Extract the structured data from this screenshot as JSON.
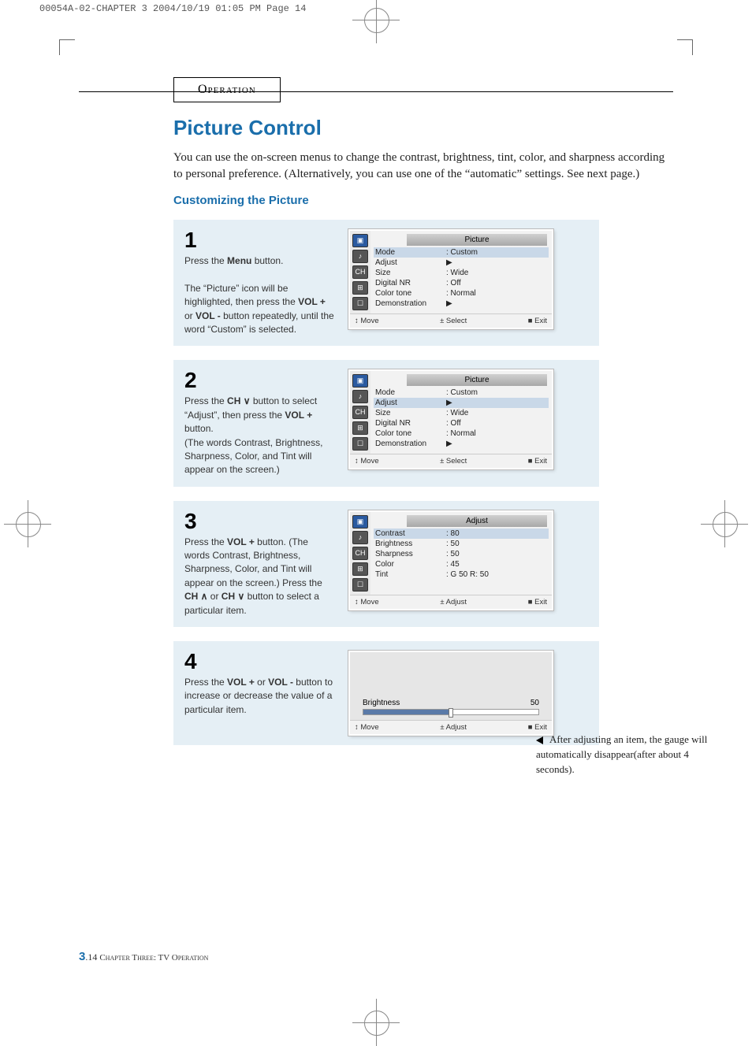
{
  "header_slug": "00054A-02-CHAPTER 3  2004/10/19  01:05 PM  Page 14",
  "section_label": "Operation",
  "title": "Picture Control",
  "intro": "You can use the on-screen menus to change the contrast, brightness, tint, color, and sharpness according to personal preference. (Alternatively, you can use one of the “automatic” settings. See next page.)",
  "subhead": "Customizing the Picture",
  "steps": [
    {
      "num": "1",
      "text_p1": "Press the ",
      "text_b1": "Menu",
      "text_p2": " button.",
      "text_p3": "The “Picture” icon will be highlighted, then press the ",
      "text_b2": "VOL +",
      "text_mid": " or ",
      "text_b3": "VOL -",
      "text_p4": " button repeatedly, until the word “Custom” is selected.",
      "osd_type": "picture",
      "osd": {
        "title": "Picture",
        "rows": [
          {
            "label": "Mode",
            "val": ": Custom",
            "highlight": true
          },
          {
            "label": "Adjust",
            "val": "▶"
          },
          {
            "label": "Size",
            "val": ": Wide"
          },
          {
            "label": "Digital NR",
            "val": ": Off"
          },
          {
            "label": "Color tone",
            "val": ": Normal"
          },
          {
            "label": "Demonstration",
            "val": "▶"
          }
        ],
        "footer": {
          "left": "↕ Move",
          "mid": "± Select",
          "right": "■ Exit"
        }
      }
    },
    {
      "num": "2",
      "text_p1": "Press the  ",
      "text_b1": "CH ∨",
      "text_p2": "  button to select “Adjust”, then press the ",
      "text_b2": "VOL +",
      "text_p3": " button.\n(The words Contrast, Brightness, Sharpness, Color, and Tint will appear on the screen.)",
      "osd_type": "picture",
      "osd": {
        "title": "Picture",
        "rows": [
          {
            "label": "Mode",
            "val": ": Custom"
          },
          {
            "label": "Adjust",
            "val": "▶",
            "highlight": true
          },
          {
            "label": "Size",
            "val": ": Wide"
          },
          {
            "label": "Digital NR",
            "val": ": Off"
          },
          {
            "label": "Color tone",
            "val": ": Normal"
          },
          {
            "label": "Demonstration",
            "val": "▶"
          }
        ],
        "footer": {
          "left": "↕ Move",
          "mid": "± Select",
          "right": "■ Exit"
        }
      }
    },
    {
      "num": "3",
      "text_p1": "Press the ",
      "text_b1": "VOL +",
      "text_p2": " button. (The words Contrast, Brightness, Sharpness, Color, and Tint will appear on the screen.) Press the ",
      "text_b2": "CH ∧",
      "text_mid": "  or  ",
      "text_b3": "CH ∨",
      "text_p3": " button to select a particular item.",
      "osd_type": "adjust",
      "osd": {
        "title": "Adjust",
        "rows": [
          {
            "label": "Contrast",
            "val": ": 80",
            "highlight": true
          },
          {
            "label": "Brightness",
            "val": ": 50"
          },
          {
            "label": "Sharpness",
            "val": ": 50"
          },
          {
            "label": "Color",
            "val": ": 45"
          },
          {
            "label": "Tint",
            "val": ": G 50    R: 50"
          }
        ],
        "footer": {
          "left": "↕ Move",
          "mid": "± Adjust",
          "right": "■ Exit"
        }
      }
    },
    {
      "num": "4",
      "text_p1": "Press the ",
      "text_b1": "VOL +",
      "text_mid": " or ",
      "text_b2": "VOL -",
      "text_p2": " button to increase or decrease the value of a particular item.",
      "osd_type": "gauge",
      "gauge": {
        "label": "Brightness",
        "value": "50",
        "footer": {
          "left": "↕ Move",
          "mid": "± Adjust",
          "right": "■ Exit"
        }
      }
    }
  ],
  "side_note": "After adjusting an item, the gauge will automatically disappear(after about 4 seconds).",
  "footer": {
    "chap_num": "3",
    "page": ".14",
    "text": " Chapter Three: TV Operation"
  }
}
